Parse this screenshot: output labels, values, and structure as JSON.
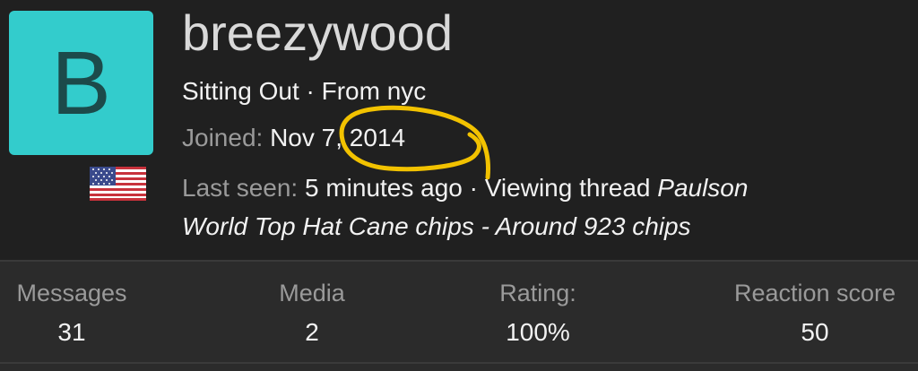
{
  "profile": {
    "avatar_letter": "B",
    "avatar_color": "#33cccc",
    "avatar_text_color": "#1c4a4a",
    "username": "breezywood",
    "status": "Sitting Out",
    "separator": "·",
    "location": "From nyc",
    "joined_label": "Joined:",
    "joined_date": "Nov 7, 2014",
    "last_seen_label": "Last seen:",
    "last_seen_time": "5 minutes ago",
    "activity_prefix": "· Viewing thread",
    "thread_title_part1": "Paulson",
    "thread_title_part2": "World Top Hat Cane chips - Around 923 chips",
    "flag_icon": "us-flag-icon",
    "highlight_color": "#f2c200"
  },
  "stats": [
    {
      "label": "Messages",
      "value": "31"
    },
    {
      "label": "Media",
      "value": "2"
    },
    {
      "label": "Rating:",
      "value": "100%"
    },
    {
      "label": "Reaction score",
      "value": "50"
    }
  ]
}
